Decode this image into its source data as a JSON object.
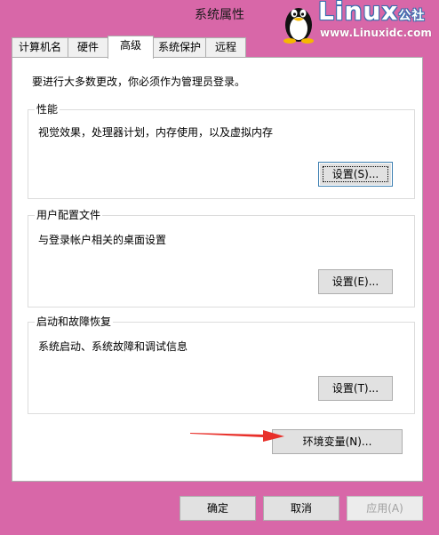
{
  "window": {
    "title": "系统属性"
  },
  "watermark": {
    "brand": "Linux",
    "brand_cn": "公社",
    "url": "www.Linuxidc.com"
  },
  "tabs": [
    {
      "label": "计算机名",
      "active": false
    },
    {
      "label": "硬件",
      "active": false
    },
    {
      "label": "高级",
      "active": true
    },
    {
      "label": "系统保护",
      "active": false
    },
    {
      "label": "远程",
      "active": false
    }
  ],
  "advanced": {
    "notice": "要进行大多数更改，你必须作为管理员登录。",
    "performance": {
      "label": "性能",
      "description": "视觉效果，处理器计划，内存使用，以及虚拟内存",
      "button": "设置(S)..."
    },
    "user_profiles": {
      "label": "用户配置文件",
      "description": "与登录帐户相关的桌面设置",
      "button": "设置(E)..."
    },
    "startup_recovery": {
      "label": "启动和故障恢复",
      "description": "系统启动、系统故障和调试信息",
      "button": "设置(T)..."
    },
    "env_button": "环境变量(N)..."
  },
  "footer": {
    "ok": "确定",
    "cancel": "取消",
    "apply": "应用(A)"
  },
  "colors": {
    "background": "#d867a8",
    "annotation_arrow": "#e8302a"
  }
}
